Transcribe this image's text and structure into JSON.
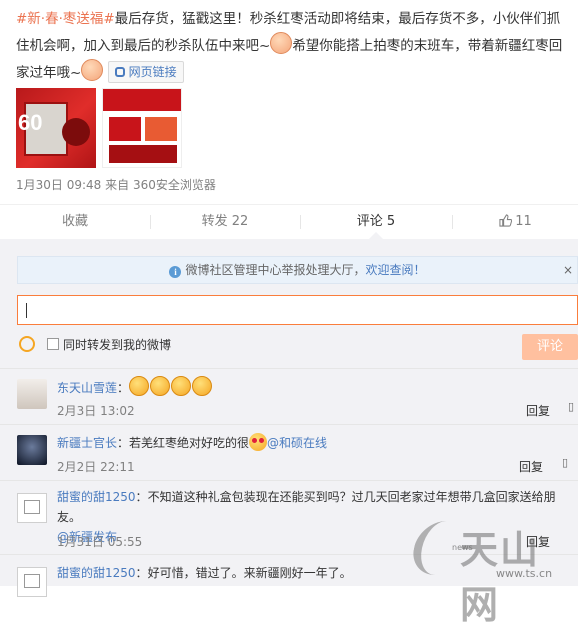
{
  "post": {
    "hashtag": "#新·春·枣送福#",
    "text1": "最后存货，猛戳这里！秒杀红枣活动即将结束，最后存货不多，小伙伴们抓住机会啊，加入到最后的秒杀队伍中来吧~",
    "text2": "希望你能搭上拍枣的末班车，带着新疆红枣回家过年哦~",
    "link_label": "网页链接",
    "thumb1_text": "60"
  },
  "meta": {
    "time": "1月30日 09:48",
    "source": "来自 360安全浏览器"
  },
  "actions": {
    "collect": "收藏",
    "forward": "转发 22",
    "comment": "评论 5",
    "like": "11"
  },
  "notice": {
    "text": "微博社区管理中心举报处理大厅，",
    "link": "欢迎查阅！",
    "close": "×"
  },
  "compose": {
    "checkbox_label": "同时转发到我的微博",
    "submit": "评论"
  },
  "comments": [
    {
      "user": "东天山雪莲",
      "sep": "：",
      "text": "",
      "time": "2月3日 13:02",
      "reply": "回复"
    },
    {
      "user": "新疆士官长",
      "sep": "：",
      "text": "若羌红枣绝对好吃的很",
      "mention": "@和硕在线",
      "time": "2月2日 22:11",
      "reply": "回复"
    },
    {
      "user": "甜蜜的甜1250",
      "sep": "：",
      "text": "不知道这种礼盒包装现在还能买到吗？过几天回老家过年想带几盒回家送给朋友。",
      "mention": "@新疆发布",
      "time": "1月31日 05:55",
      "reply": "回复"
    },
    {
      "user": "甜蜜的甜1250",
      "sep": "：",
      "text": "好可惜，错过了。来新疆刚好一年了。",
      "time": "",
      "reply": ""
    }
  ],
  "watermark": {
    "brand": "天山网",
    "news": "news",
    "url": "www.ts.cn"
  }
}
